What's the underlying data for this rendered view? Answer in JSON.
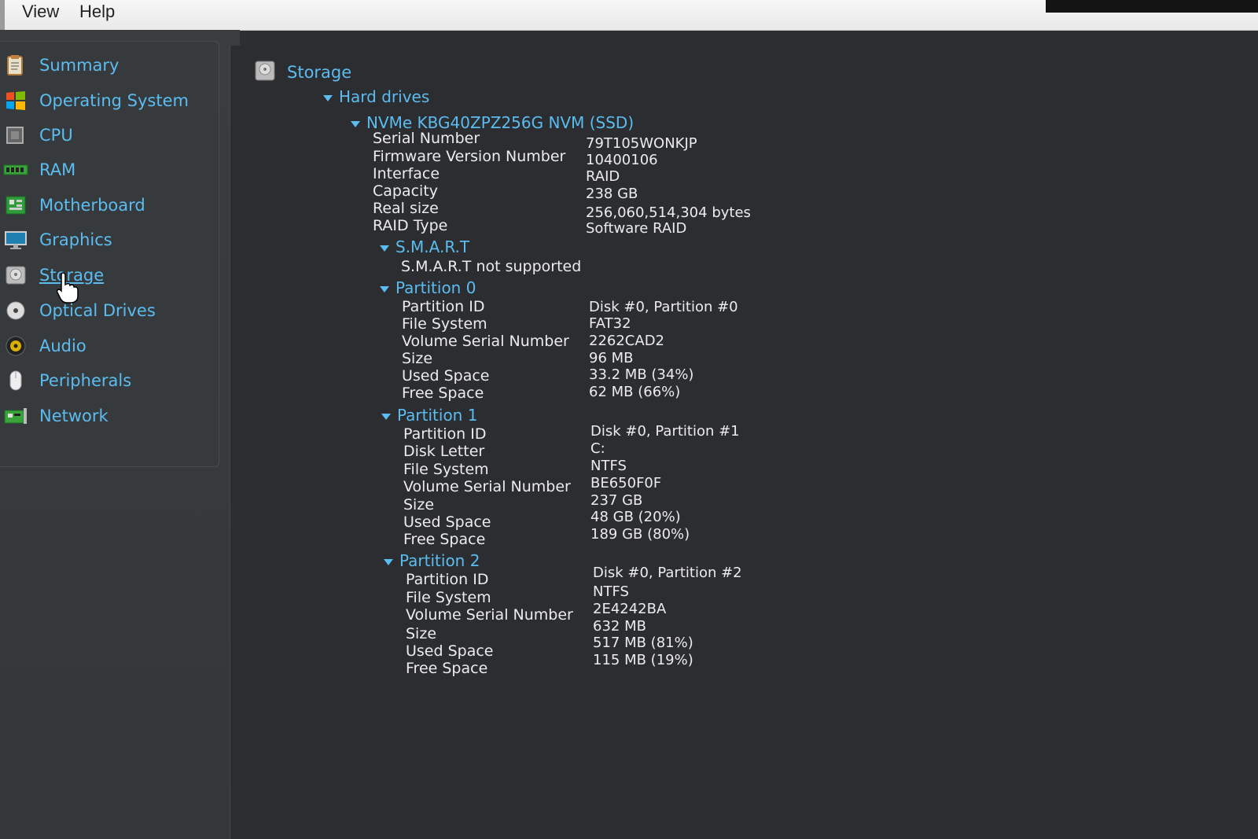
{
  "menu": {
    "items": [
      "View",
      "Help"
    ]
  },
  "sidebar": {
    "items": [
      {
        "label": "Summary",
        "icon": "clipboard-icon"
      },
      {
        "label": "Operating System",
        "icon": "windows-logo-icon"
      },
      {
        "label": "CPU",
        "icon": "cpu-chip-icon"
      },
      {
        "label": "RAM",
        "icon": "ram-module-icon"
      },
      {
        "label": "Motherboard",
        "icon": "motherboard-icon"
      },
      {
        "label": "Graphics",
        "icon": "monitor-icon"
      },
      {
        "label": "Storage",
        "icon": "hard-drive-icon"
      },
      {
        "label": "Optical Drives",
        "icon": "optical-disc-icon"
      },
      {
        "label": "Audio",
        "icon": "speaker-icon"
      },
      {
        "label": "Peripherals",
        "icon": "mouse-icon"
      },
      {
        "label": "Network",
        "icon": "network-card-icon"
      }
    ],
    "active": "Storage"
  },
  "main": {
    "title": "Storage",
    "hard_drives_label": "Hard drives",
    "drive": {
      "name": "NVMe KBG40ZPZ256G NVM (SSD)",
      "props": [
        {
          "label": "Serial Number",
          "value": "79T105WONKJP"
        },
        {
          "label": "Firmware Version Number",
          "value": "10400106"
        },
        {
          "label": "Interface",
          "value": "RAID"
        },
        {
          "label": "Capacity",
          "value": "238 GB"
        },
        {
          "label": "Real size",
          "value": "256,060,514,304 bytes"
        },
        {
          "label": "RAID Type",
          "value": "Software RAID"
        }
      ],
      "smart": {
        "label": "S.M.A.R.T",
        "message": "S.M.A.R.T not supported"
      },
      "partitions": [
        {
          "label": "Partition 0",
          "props": [
            {
              "label": "Partition ID",
              "value": "Disk #0, Partition #0"
            },
            {
              "label": "File System",
              "value": "FAT32"
            },
            {
              "label": "Volume Serial Number",
              "value": "2262CAD2"
            },
            {
              "label": "Size",
              "value": "96 MB"
            },
            {
              "label": "Used Space",
              "value": "33.2 MB (34%)"
            },
            {
              "label": "Free Space",
              "value": "62 MB (66%)"
            }
          ]
        },
        {
          "label": "Partition 1",
          "props": [
            {
              "label": "Partition ID",
              "value": "Disk #0, Partition #1"
            },
            {
              "label": "Disk Letter",
              "value": "C:"
            },
            {
              "label": "File System",
              "value": "NTFS"
            },
            {
              "label": "Volume Serial Number",
              "value": "BE650F0F"
            },
            {
              "label": "Size",
              "value": "237 GB"
            },
            {
              "label": "Used Space",
              "value": "48 GB (20%)"
            },
            {
              "label": "Free Space",
              "value": "189 GB (80%)"
            }
          ]
        },
        {
          "label": "Partition 2",
          "props": [
            {
              "label": "Partition ID",
              "value": "Disk #0, Partition #2"
            },
            {
              "label": "File System",
              "value": "NTFS"
            },
            {
              "label": "Volume Serial Number",
              "value": "2E4242BA"
            },
            {
              "label": "Size",
              "value": "632 MB"
            },
            {
              "label": "Used Space",
              "value": "517 MB (81%)"
            },
            {
              "label": "Free Space",
              "value": "115 MB (19%)"
            }
          ]
        }
      ]
    }
  },
  "colors": {
    "link": "#5bbcf0",
    "text": "#ececec",
    "background": "#2b2d30"
  }
}
